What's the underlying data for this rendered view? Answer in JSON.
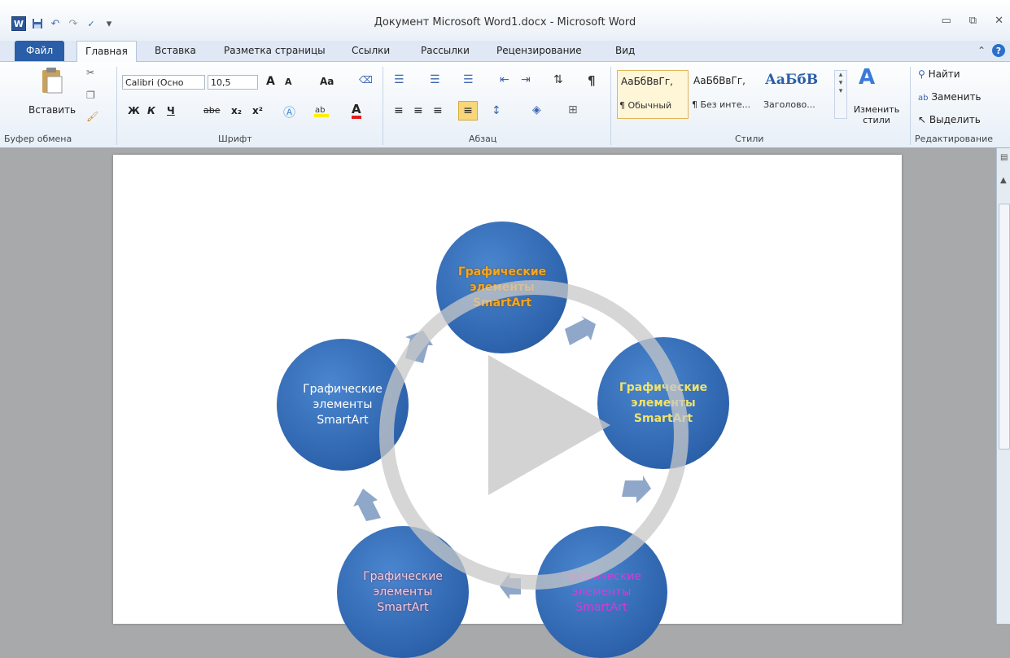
{
  "window": {
    "title": "Документ Microsoft Word1.docx - Microsoft Word",
    "qat_icons": [
      "word-logo-icon",
      "save-icon",
      "undo-icon",
      "redo-icon",
      "spellcheck-icon",
      "customize-qat-icon"
    ],
    "controls": [
      "minimize",
      "restore",
      "close"
    ],
    "word_logo_letter": "W"
  },
  "tabs": [
    "Файл",
    "Главная",
    "Вставка",
    "Разметка страницы",
    "Ссылки",
    "Рассылки",
    "Рецензирование",
    "Вид"
  ],
  "active_tab": "Главная",
  "ribbon": {
    "clipboard": {
      "label": "Буфер обмена",
      "paste": "Вставить"
    },
    "font": {
      "label": "Шрифт",
      "font_name": "Calibri (Осно",
      "font_size": "10,5",
      "grow": "A",
      "shrink": "A",
      "case": "Aa",
      "bold": "Ж",
      "italic": "К",
      "underline": "Ч",
      "strike": "abe",
      "subscript": "x₂",
      "superscript": "x²",
      "color_letter": "A"
    },
    "paragraph": {
      "label": "Абзац"
    },
    "styles": {
      "label": "Стили",
      "items": [
        {
          "sample": "АаБбВвГг,",
          "name": "¶ Обычный"
        },
        {
          "sample": "АаБбВвГг,",
          "name": "¶ Без инте..."
        },
        {
          "sample": "АаБбВ",
          "name": "Заголово..."
        }
      ],
      "change": "Изменить стили"
    },
    "editing": {
      "label": "Редактирование",
      "find": "Найти",
      "replace": "Заменить",
      "select": "Выделить"
    }
  },
  "document": {
    "circles": [
      {
        "lines": [
          "Графические",
          "элементы",
          "SmartArt"
        ],
        "color": "#f5a623"
      },
      {
        "lines": [
          "Графические",
          "элементы",
          "SmartArt"
        ],
        "color": "#f0e26a"
      },
      {
        "lines": [
          "Графические",
          "элементы",
          "SmartArt"
        ],
        "color": "#d63bd6"
      },
      {
        "lines": [
          "Графические",
          "элементы",
          "SmartArt"
        ],
        "color": "#e8d0e0"
      },
      {
        "lines": [
          "Графические",
          "элементы",
          "SmartArt"
        ],
        "color": "#ffffff"
      }
    ]
  },
  "overlay": {
    "type": "play-button"
  }
}
